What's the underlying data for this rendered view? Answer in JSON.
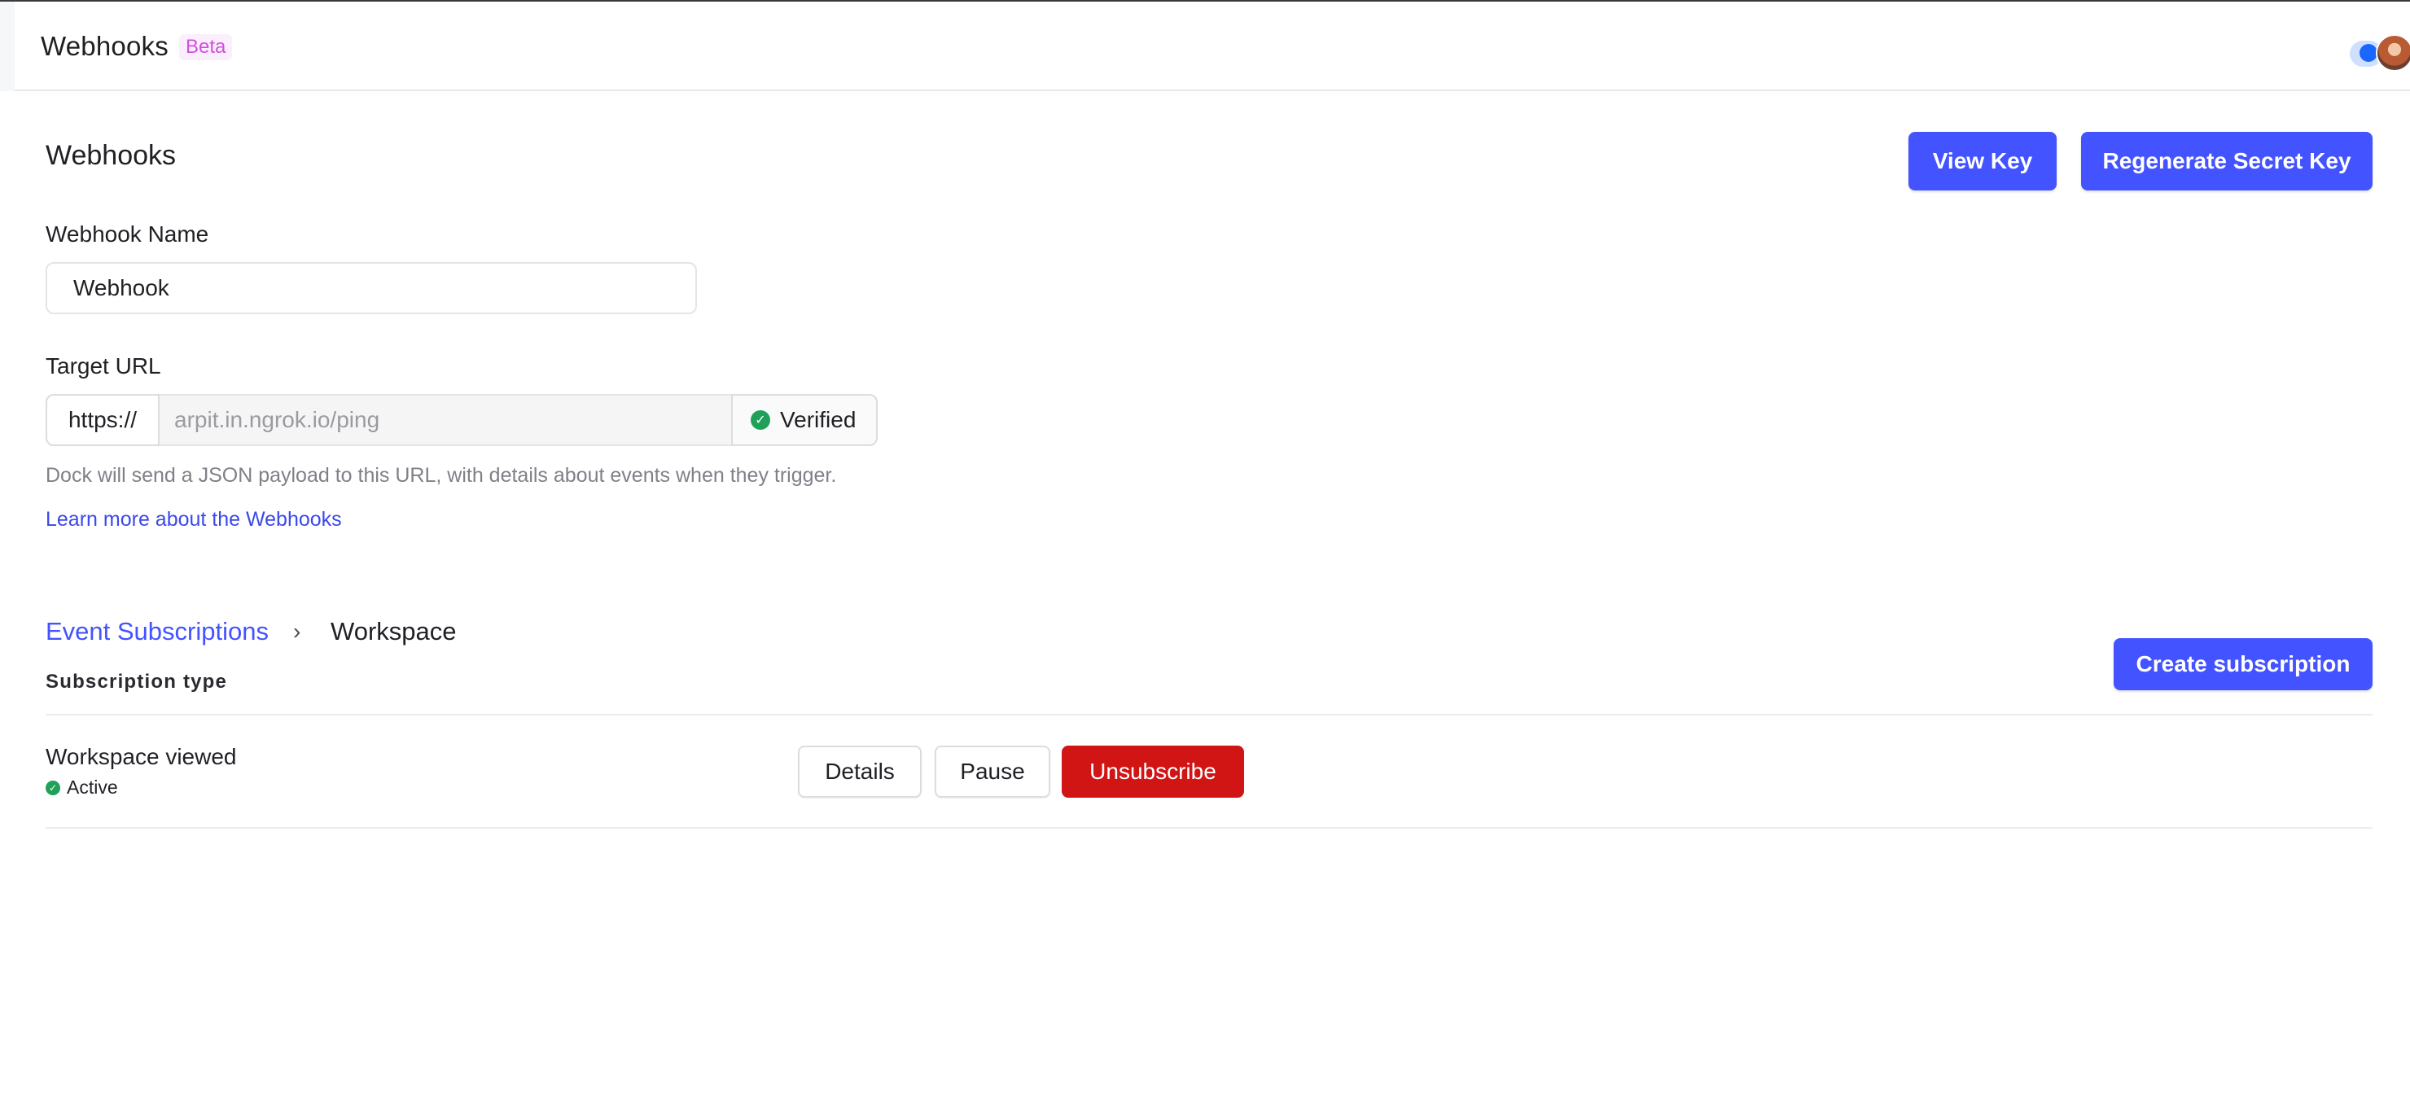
{
  "header": {
    "app_title": "Webhooks",
    "badge": "Beta"
  },
  "page": {
    "title": "Webhooks",
    "actions": {
      "view_key": "View Key",
      "regenerate_secret": "Regenerate Secret Key"
    }
  },
  "form": {
    "webhook_name": {
      "label": "Webhook Name",
      "value": "Webhook"
    },
    "target_url": {
      "label": "Target URL",
      "prefix": "https://",
      "value": "arpit.in.ngrok.io/ping",
      "status": "Verified"
    },
    "help_text": "Dock will send a JSON payload to this URL, with details about events when they trigger.",
    "learn_more": "Learn more about the Webhooks"
  },
  "subscriptions": {
    "breadcrumb": {
      "parent": "Event Subscriptions",
      "separator": "›",
      "current": "Workspace"
    },
    "column_header": "Subscription type",
    "create_label": "Create subscription",
    "rows": [
      {
        "name": "Workspace viewed",
        "status": "Active",
        "actions": {
          "details": "Details",
          "pause": "Pause",
          "unsubscribe": "Unsubscribe"
        }
      }
    ]
  },
  "colors": {
    "primary": "#4353ff",
    "danger": "#d11414",
    "success": "#1fa15a",
    "beta": "#d24fe0"
  }
}
